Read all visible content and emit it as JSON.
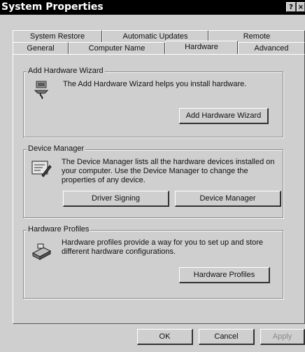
{
  "window": {
    "title": "System Properties",
    "help_button": "?",
    "close_button": "×"
  },
  "tabs": {
    "row1": [
      "System Restore",
      "Automatic Updates",
      "Remote"
    ],
    "row2": [
      "General",
      "Computer Name",
      "Hardware",
      "Advanced"
    ],
    "active": "Hardware"
  },
  "add_hardware": {
    "group_title": "Add Hardware Wizard",
    "description": "The Add Hardware Wizard helps you install hardware.",
    "button": "Add Hardware Wizard",
    "icon": "add-hardware-icon"
  },
  "device_manager": {
    "group_title": "Device Manager",
    "description": "The Device Manager lists all the hardware devices installed on your computer. Use the Device Manager to change the properties of any device.",
    "driver_signing_button": "Driver Signing",
    "device_manager_button": "Device Manager",
    "icon": "device-manager-icon"
  },
  "hardware_profiles": {
    "group_title": "Hardware Profiles",
    "description": "Hardware profiles provide a way for you to set up and store different hardware configurations.",
    "button": "Hardware Profiles",
    "icon": "hardware-profiles-icon"
  },
  "footer": {
    "ok": "OK",
    "cancel": "Cancel",
    "apply": "Apply"
  },
  "colors": {
    "titlebar": "#000000",
    "face": "#cfcfcf"
  }
}
